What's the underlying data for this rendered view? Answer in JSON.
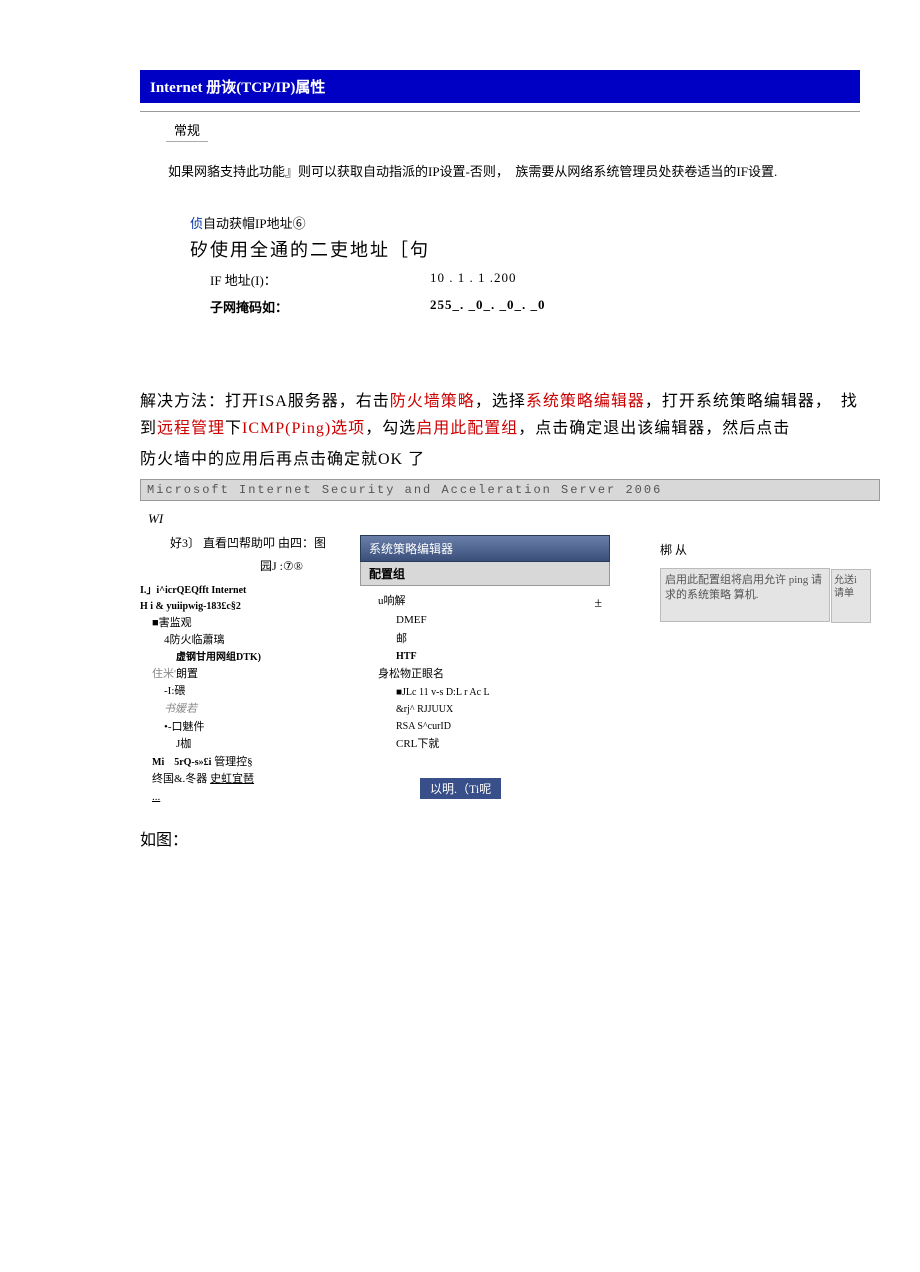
{
  "tcpip": {
    "title": "Internet 册诙(TCP/IP)属性",
    "tab": "常规",
    "desc": "如果网貉支持此功能』则可以获取自动指派的IP设置-否则，　族需要从网络系统管理员处获卷适当的IF设置.",
    "radio1_prefix": "侦",
    "radio1_rest": "自动获帽IP地址⑥",
    "radio2": "矽使用全通的二吏地址［句",
    "ip_label": "IF 地址(I)：",
    "ip_value": "10 . 1 . 1 .200",
    "mask_label": "子网掩码如：",
    "mask_value": "255_. _0_. _0_. _0"
  },
  "solution": {
    "p1a": "解决方法：打开ISA服务器，右击",
    "p1b": "防火墙策略",
    "p1c": "，选择",
    "p1d": "系统策略编辑器",
    "p1e": "，打开系统策略编辑器，　找到",
    "p1f": "远程管理",
    "p1g": "下",
    "p1h": "ICMP(Ping)选项",
    "p1i": "，勾选",
    "p1j": "启用此配置组",
    "p1k": "，点击确定退出该编辑器，然后点击",
    "p2": "防火墙中的应用后再点击确定就OK 了",
    "caption": "如图："
  },
  "isa": {
    "titlebar": "Microsoft Internet Security and Acceleration Server 2006",
    "close_glyph": "_",
    "help_glyph": "?",
    "left": {
      "wi_label": "WI",
      "toolbar": "好3〕 直看凹帮助叩  由四：图",
      "toolbar2": "园J :⑦®",
      "line1": "I.」i^icrQEQfft Internet",
      "line2": "H i & yuiipwig-183£c§2",
      "t1": "■害监观",
      "t2": "4防火临蕭璃",
      "t3": "虚钢甘用网组DTK)",
      "t4_pre": "住米'",
      "t4": "朗置",
      "t5": "-I:碨",
      "t6": "书媛若",
      "t7": "•-口魅件",
      "t8": "J枷",
      "t9a": "Mi　5rQ-s»£i",
      "t9b": "管理控§",
      "t10a": "终国&.冬器",
      "t10b": "史虹宜琶"
    },
    "mid": {
      "title": "系统策略编辑器",
      "sub": "配置组",
      "l1": "u响解",
      "glyph": "±",
      "l2": "DMEF",
      "l3": "邮",
      "l4": "HTF",
      "l5": "身松物正眼名",
      "l6": "■JLc 11 v-s D:L r Ac L",
      "l7": "&rj^ RJJUUX",
      "l8": "RSA S^curID",
      "l9": "CRL下就",
      "ok": "以明.（Ti呢"
    },
    "right": {
      "top": "梆  从",
      "desc1": "启用此配置组将启用允许 ping 请求的系统策略 算机.",
      "desc2": "允送i 请单"
    }
  }
}
